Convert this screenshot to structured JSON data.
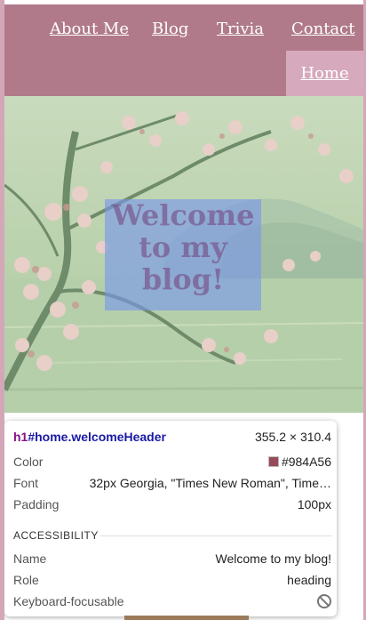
{
  "nav": {
    "items": [
      "About Me",
      "Blog",
      "Trivia",
      "Contact"
    ],
    "home": "Home"
  },
  "hero": {
    "heading": "Welcome to my blog!"
  },
  "inspector": {
    "selector_tag": "h1",
    "selector_rest": "#home.welcomeHeader",
    "size": "355.2 × 310.4",
    "color_label": "Color",
    "color_value": "#984A56",
    "font_label": "Font",
    "font_value": "32px Georgia, \"Times New Roman\", Time…",
    "padding_label": "Padding",
    "padding_value": "100px",
    "accessibility_heading": "ACCESSIBILITY",
    "name_label": "Name",
    "name_value": "Welcome to my blog!",
    "role_label": "Role",
    "role_value": "heading",
    "keyboard_label": "Keyboard-focusable"
  },
  "colors": {
    "nav_bg": "#b07a8a",
    "home_bg": "#d6a9bd",
    "page_border": "#d4a7b8",
    "heading_color": "#984A56",
    "highlight": "#7896eb"
  }
}
